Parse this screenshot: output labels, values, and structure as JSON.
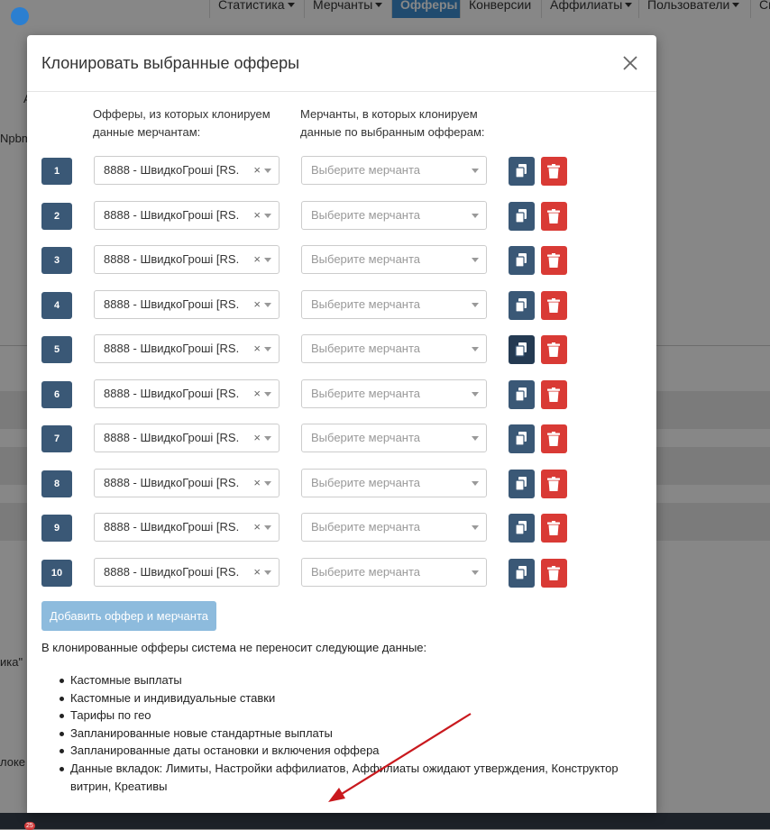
{
  "topnav": {
    "items": [
      {
        "label": "Статистика",
        "caret": true
      },
      {
        "label": "Мерчанты",
        "caret": true
      },
      {
        "label": "Офферы",
        "caret": false,
        "active": true
      },
      {
        "label": "Конверсии",
        "caret": false
      },
      {
        "label": "Аффилиаты",
        "caret": true
      },
      {
        "label": "Пользователи",
        "caret": true
      },
      {
        "label": "Сп",
        "caret": false
      }
    ]
  },
  "background": {
    "fragments": [
      "Npbm",
      "A",
      "ика\"",
      "локе \""
    ]
  },
  "taskbar": {
    "badge": "25"
  },
  "modal": {
    "title": "Клонировать выбранные офферы",
    "col_offers_header": "Офферы, из которых клонируем данные мерчантам:",
    "col_merchants_header": "Мерчанты, в которых клонируем данные по выбранным офферам:",
    "rows": [
      {
        "num": "1",
        "offer": "8888 - ШвидкоГроші [RS...",
        "merchant_placeholder": "Выберите мерчанта"
      },
      {
        "num": "2",
        "offer": "8888 - ШвидкоГроші [RS...",
        "merchant_placeholder": "Выберите мерчанта"
      },
      {
        "num": "3",
        "offer": "8888 - ШвидкоГроші [RS...",
        "merchant_placeholder": "Выберите мерчанта"
      },
      {
        "num": "4",
        "offer": "8888 - ШвидкоГроші [RS...",
        "merchant_placeholder": "Выберите мерчанта"
      },
      {
        "num": "5",
        "offer": "8888 - ШвидкоГроші [RS...",
        "merchant_placeholder": "Выберите мерчанта"
      },
      {
        "num": "6",
        "offer": "8888 - ШвидкоГроші [RS...",
        "merchant_placeholder": "Выберите мерчанта"
      },
      {
        "num": "7",
        "offer": "8888 - ШвидкоГроші [RS...",
        "merchant_placeholder": "Выберите мерчанта"
      },
      {
        "num": "8",
        "offer": "8888 - ШвидкоГроші [RS...",
        "merchant_placeholder": "Выберите мерчанта"
      },
      {
        "num": "9",
        "offer": "8888 - ШвидкоГроші [RS...",
        "merchant_placeholder": "Выберите мерчанта"
      },
      {
        "num": "10",
        "offer": "8888 - ШвидкоГроші [RS...",
        "merchant_placeholder": "Выберите мерчанта"
      }
    ],
    "clear_glyph": "×",
    "add_button": "Добавить оффер и мерчанта",
    "note": "В клонированные офферы система не переносит следующие данные:",
    "bullets": [
      "Кастомные выплаты",
      "Кастомные и индивидуальные ставки",
      "Тарифы по гео",
      "Запланированные новые стандартные выплаты",
      "Запланированные даты остановки и включения оффера",
      "Данные вкладок: Лимиты, Настройки аффилиатов, Аффилиаты ожидают утверждения, Конструктор витрин, Креативы"
    ]
  },
  "colors": {
    "accent": "#3d8fd1",
    "row_badge": "#3a5876",
    "delete": "#d93a35",
    "add_button": "#8dbbdd",
    "annotation_arrow": "#c9191e"
  },
  "icons": {
    "close": "close-icon",
    "copy": "copy-icon",
    "delete": "trash-icon"
  }
}
